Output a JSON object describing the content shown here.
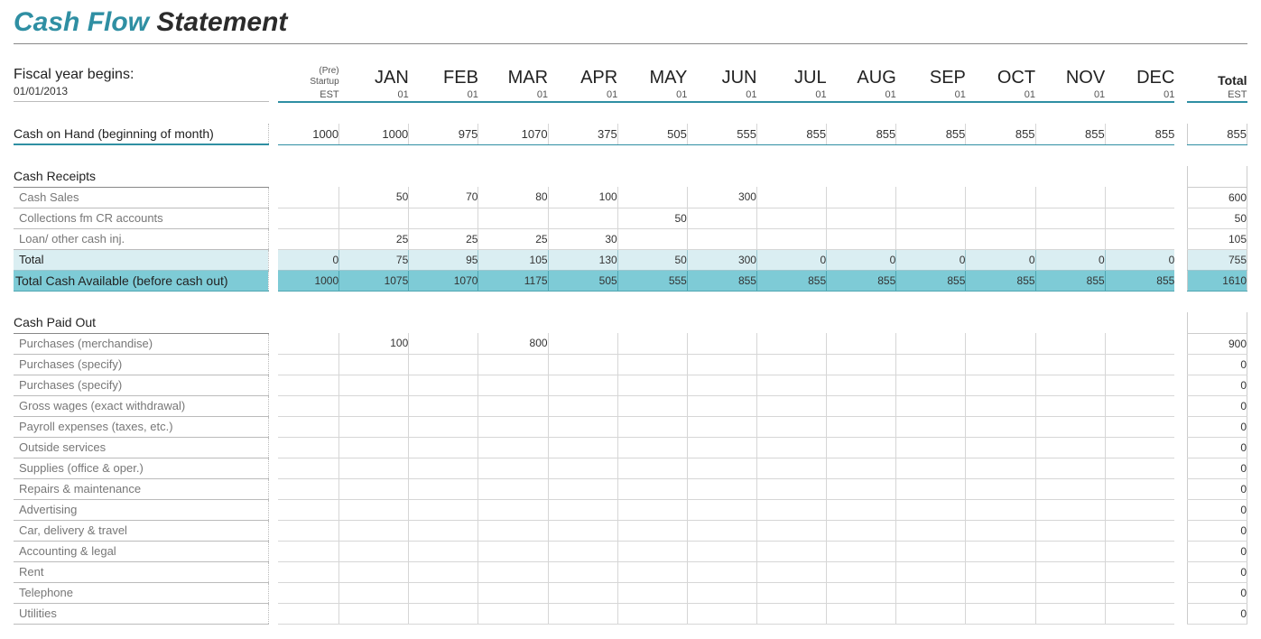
{
  "title_cf": "Cash Flow",
  "title_rest": " Statement",
  "fiscal_year_label": "Fiscal year begins:",
  "fiscal_year_date": "01/01/2013",
  "header": {
    "pre_line1": "(Pre)",
    "pre_line2": "Startup",
    "pre_line3": "EST",
    "months": [
      "JAN",
      "FEB",
      "MAR",
      "APR",
      "MAY",
      "JUN",
      "JUL",
      "AUG",
      "SEP",
      "OCT",
      "NOV",
      "DEC"
    ],
    "month_sub": "01",
    "total_label": "Total",
    "total_sub": "EST"
  },
  "cash_on_hand": {
    "label": "Cash on Hand (beginning of month)",
    "values": [
      "1000",
      "1000",
      "975",
      "1070",
      "375",
      "505",
      "555",
      "855",
      "855",
      "855",
      "855",
      "855",
      "855"
    ],
    "total": "855"
  },
  "receipts_header": "Cash Receipts",
  "receipts": [
    {
      "label": "Cash Sales",
      "values": [
        "",
        "50",
        "70",
        "80",
        "100",
        "",
        "300",
        "",
        "",
        "",
        "",
        "",
        ""
      ],
      "total": "600"
    },
    {
      "label": "Collections fm CR accounts",
      "values": [
        "",
        "",
        "",
        "",
        "",
        "50",
        "",
        "",
        "",
        "",
        "",
        "",
        ""
      ],
      "total": "50"
    },
    {
      "label": "Loan/ other cash inj.",
      "values": [
        "",
        "25",
        "25",
        "25",
        "30",
        "",
        "",
        "",
        "",
        "",
        "",
        "",
        ""
      ],
      "total": "105"
    }
  ],
  "receipts_total": {
    "label": "Total",
    "values": [
      "0",
      "75",
      "95",
      "105",
      "130",
      "50",
      "300",
      "0",
      "0",
      "0",
      "0",
      "0",
      "0"
    ],
    "total": "755"
  },
  "total_cash_avail": {
    "label": "Total Cash Available (before cash out)",
    "values": [
      "1000",
      "1075",
      "1070",
      "1175",
      "505",
      "555",
      "855",
      "855",
      "855",
      "855",
      "855",
      "855",
      "855"
    ],
    "total": "1610"
  },
  "paid_header": "Cash Paid Out",
  "paid": [
    {
      "label": "Purchases (merchandise)",
      "values": [
        "",
        "100",
        "",
        "800",
        "",
        "",
        "",
        "",
        "",
        "",
        "",
        "",
        ""
      ],
      "total": "900"
    },
    {
      "label": "Purchases (specify)",
      "values": [
        "",
        "",
        "",
        "",
        "",
        "",
        "",
        "",
        "",
        "",
        "",
        "",
        ""
      ],
      "total": "0"
    },
    {
      "label": "Purchases (specify)",
      "values": [
        "",
        "",
        "",
        "",
        "",
        "",
        "",
        "",
        "",
        "",
        "",
        "",
        ""
      ],
      "total": "0"
    },
    {
      "label": "Gross wages (exact withdrawal)",
      "values": [
        "",
        "",
        "",
        "",
        "",
        "",
        "",
        "",
        "",
        "",
        "",
        "",
        ""
      ],
      "total": "0"
    },
    {
      "label": "Payroll expenses (taxes, etc.)",
      "values": [
        "",
        "",
        "",
        "",
        "",
        "",
        "",
        "",
        "",
        "",
        "",
        "",
        ""
      ],
      "total": "0"
    },
    {
      "label": "Outside services",
      "values": [
        "",
        "",
        "",
        "",
        "",
        "",
        "",
        "",
        "",
        "",
        "",
        "",
        ""
      ],
      "total": "0"
    },
    {
      "label": "Supplies (office & oper.)",
      "values": [
        "",
        "",
        "",
        "",
        "",
        "",
        "",
        "",
        "",
        "",
        "",
        "",
        ""
      ],
      "total": "0"
    },
    {
      "label": "Repairs & maintenance",
      "values": [
        "",
        "",
        "",
        "",
        "",
        "",
        "",
        "",
        "",
        "",
        "",
        "",
        ""
      ],
      "total": "0"
    },
    {
      "label": "Advertising",
      "values": [
        "",
        "",
        "",
        "",
        "",
        "",
        "",
        "",
        "",
        "",
        "",
        "",
        ""
      ],
      "total": "0"
    },
    {
      "label": "Car, delivery & travel",
      "values": [
        "",
        "",
        "",
        "",
        "",
        "",
        "",
        "",
        "",
        "",
        "",
        "",
        ""
      ],
      "total": "0"
    },
    {
      "label": "Accounting & legal",
      "values": [
        "",
        "",
        "",
        "",
        "",
        "",
        "",
        "",
        "",
        "",
        "",
        "",
        ""
      ],
      "total": "0"
    },
    {
      "label": "Rent",
      "values": [
        "",
        "",
        "",
        "",
        "",
        "",
        "",
        "",
        "",
        "",
        "",
        "",
        ""
      ],
      "total": "0"
    },
    {
      "label": "Telephone",
      "values": [
        "",
        "",
        "",
        "",
        "",
        "",
        "",
        "",
        "",
        "",
        "",
        "",
        ""
      ],
      "total": "0"
    },
    {
      "label": "Utilities",
      "values": [
        "",
        "",
        "",
        "",
        "",
        "",
        "",
        "",
        "",
        "",
        "",
        "",
        ""
      ],
      "total": "0"
    }
  ]
}
